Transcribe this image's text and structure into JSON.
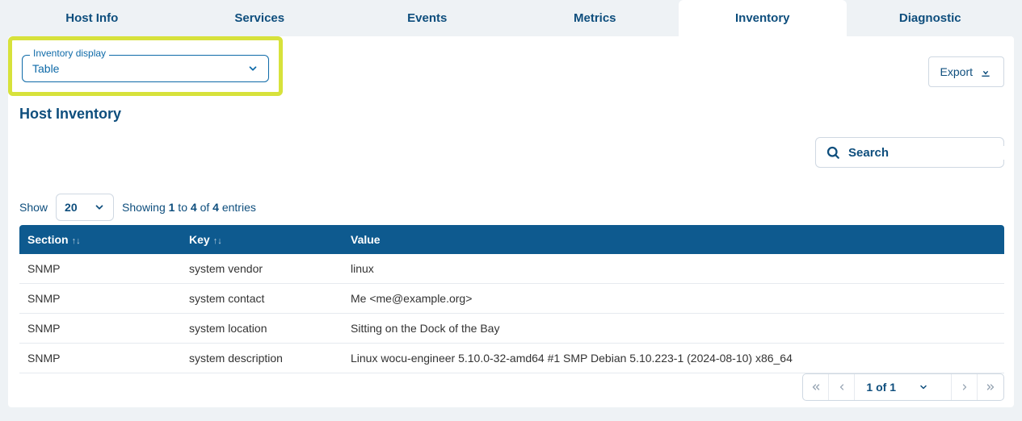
{
  "tabs": {
    "host_info": "Host Info",
    "services": "Services",
    "events": "Events",
    "metrics": "Metrics",
    "inventory": "Inventory",
    "diagnostic": "Diagnostic",
    "active": "inventory"
  },
  "inventory_display": {
    "label": "Inventory display",
    "value": "Table"
  },
  "export_label": "Export",
  "page_title": "Host Inventory",
  "search": {
    "placeholder": "Search"
  },
  "show_label": "Show",
  "page_size": "20",
  "entries_text": {
    "prefix": "Showing ",
    "from": "1",
    "mid1": " to ",
    "to": "4",
    "mid2": " of ",
    "total": "4",
    "suffix": " entries"
  },
  "columns": {
    "section": "Section",
    "key": "Key",
    "value": "Value"
  },
  "rows": [
    {
      "section": "SNMP",
      "key": "system vendor",
      "value": "linux"
    },
    {
      "section": "SNMP",
      "key": "system contact",
      "value": "Me <me@example.org>"
    },
    {
      "section": "SNMP",
      "key": "system location",
      "value": "Sitting on the Dock of the Bay"
    },
    {
      "section": "SNMP",
      "key": "system description",
      "value": "Linux wocu-engineer 5.10.0-32-amd64 #1 SMP Debian 5.10.223-1 (2024-08-10) x86_64"
    }
  ],
  "pagination": {
    "label": "1 of 1"
  }
}
